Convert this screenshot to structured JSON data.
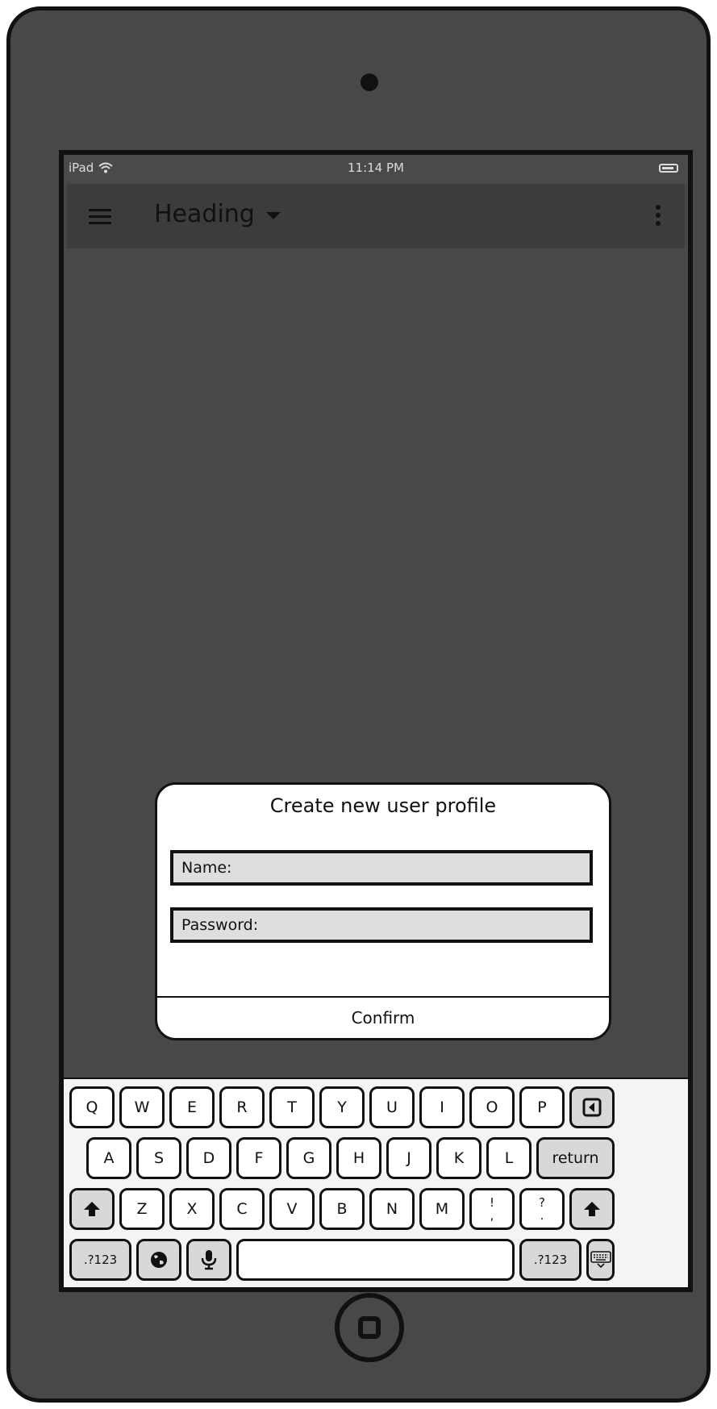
{
  "status_bar": {
    "carrier": "iPad",
    "wifi_icon": "wifi-icon",
    "time": "11:14 PM",
    "battery_icon": "battery-icon"
  },
  "toolbar": {
    "menu_icon": "hamburger-menu-icon",
    "heading": "Heading",
    "dropdown_icon": "caret-down-icon",
    "overflow_icon": "kebab-menu-icon"
  },
  "dialog": {
    "title": "Create new user profile",
    "name_label": "Name:",
    "password_label": "Password:",
    "confirm_label": "Confirm"
  },
  "keyboard": {
    "row1": [
      "Q",
      "W",
      "E",
      "R",
      "T",
      "Y",
      "U",
      "I",
      "O",
      "P"
    ],
    "backspace_icon": "backspace-icon",
    "row2": [
      "A",
      "S",
      "D",
      "F",
      "G",
      "H",
      "J",
      "K",
      "L"
    ],
    "return_label": "return",
    "row3": [
      "Z",
      "X",
      "C",
      "V",
      "B",
      "N",
      "M"
    ],
    "punct1": [
      "!",
      ","
    ],
    "punct2": [
      "?",
      "."
    ],
    "shift_icon": "shift-arrow-icon",
    "numbers_label": ".?123",
    "globe_icon": "globe-icon",
    "mic_icon": "microphone-icon",
    "hide_keyboard_icon": "hide-keyboard-icon"
  },
  "device": {
    "camera_icon": "camera-icon",
    "home_button_icon": "home-button-icon"
  }
}
